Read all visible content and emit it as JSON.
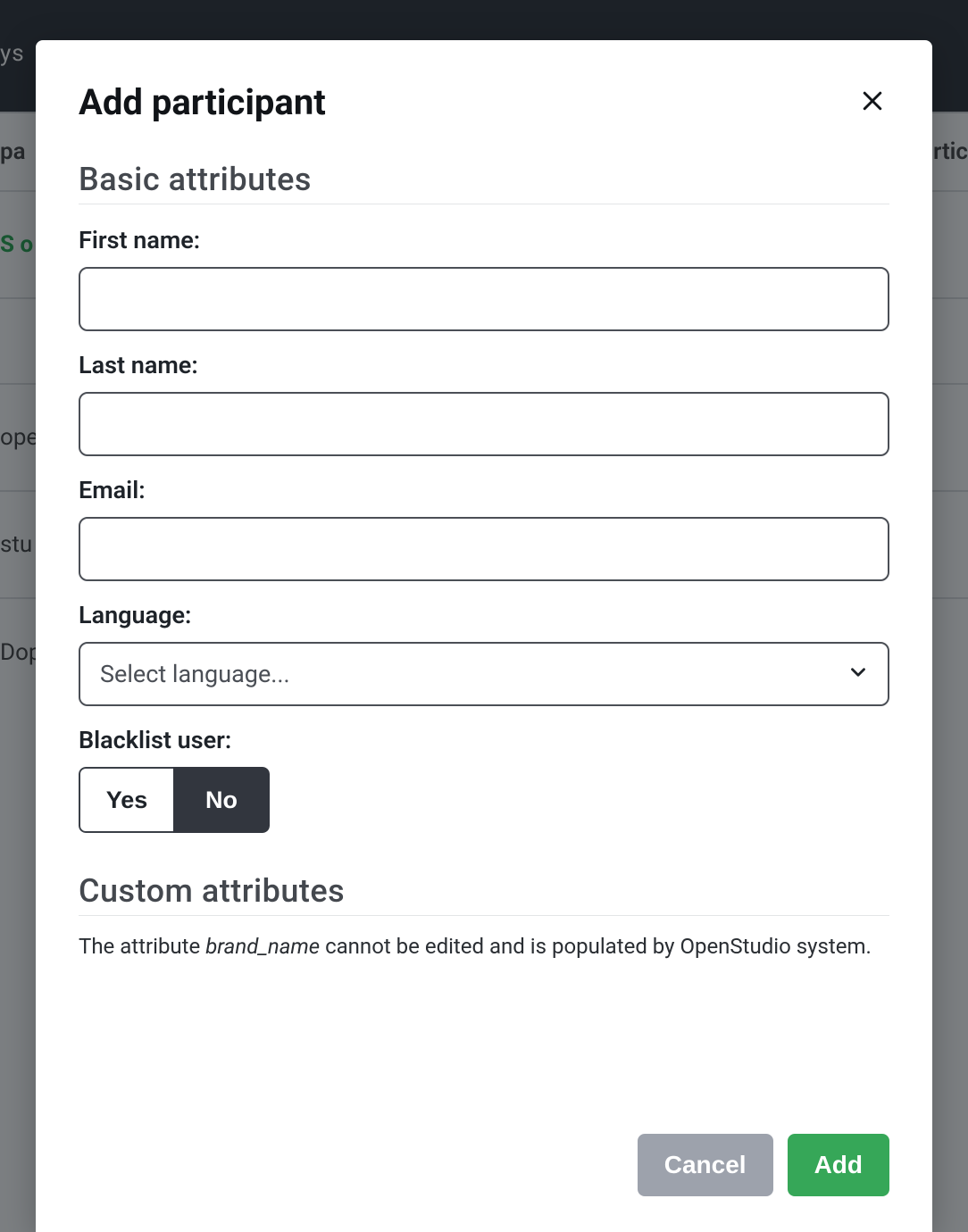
{
  "background": {
    "header_snippet": "ys",
    "row_header_left": "pa",
    "row_header_right": "rtic",
    "green_snippet": "S o",
    "row_a": "ope",
    "row_b": "stu",
    "row_c": "Dop"
  },
  "modal": {
    "title": "Add participant",
    "sections": {
      "basic": "Basic attributes",
      "custom": "Custom attributes"
    },
    "fields": {
      "first_name": {
        "label": "First name:",
        "value": ""
      },
      "last_name": {
        "label": "Last name:",
        "value": ""
      },
      "email": {
        "label": "Email:",
        "value": ""
      },
      "language": {
        "label": "Language:",
        "placeholder": "Select language..."
      },
      "blacklist": {
        "label": "Blacklist user:",
        "yes": "Yes",
        "no": "No",
        "selected": "No"
      }
    },
    "custom_note_prefix": "The attribute ",
    "custom_note_attr": "brand_name",
    "custom_note_suffix": " cannot be edited and is populated by OpenStudio system.",
    "buttons": {
      "cancel": "Cancel",
      "add": "Add"
    }
  }
}
